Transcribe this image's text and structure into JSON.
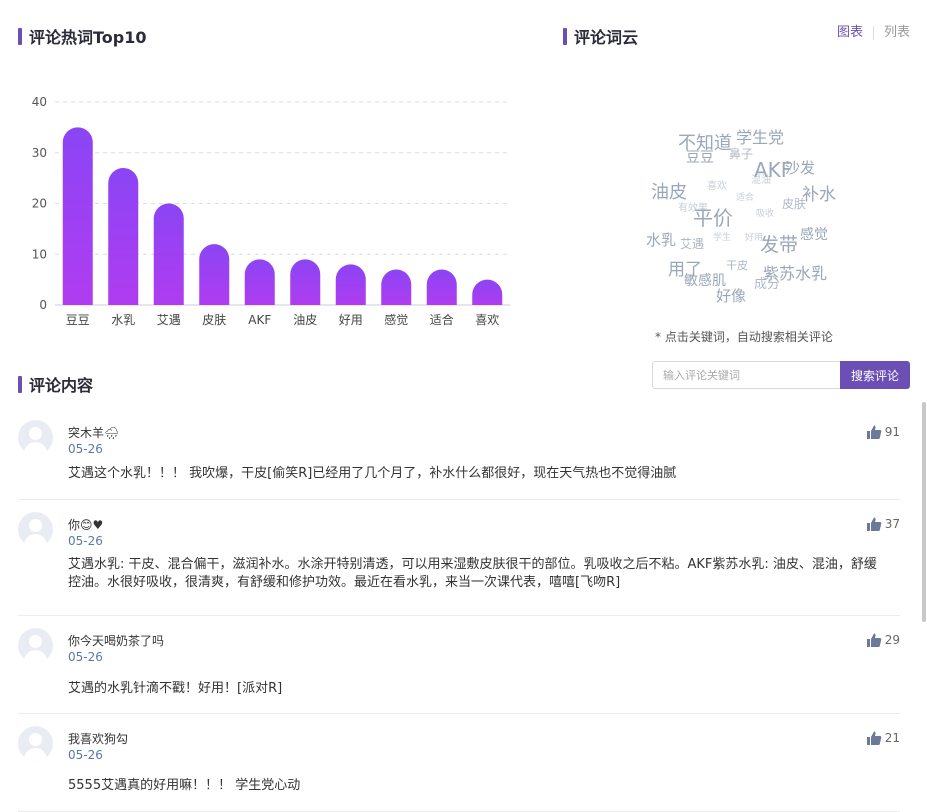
{
  "hot_words_section": {
    "title": "评论热词Top10"
  },
  "cloud_section": {
    "title": "评论词云",
    "tabs": [
      {
        "label": "图表",
        "active": true
      },
      {
        "label": "列表",
        "active": false
      }
    ],
    "hint": "* 点击关键词，自动搜索相关评论",
    "words": [
      {
        "text": "不知道",
        "size": 18
      },
      {
        "text": "学生党",
        "size": 16
      },
      {
        "text": "豆豆",
        "size": 14
      },
      {
        "text": "鼻子",
        "size": 12
      },
      {
        "text": "AKF",
        "size": 20
      },
      {
        "text": "沙发",
        "size": 15
      },
      {
        "text": "油皮",
        "size": 18
      },
      {
        "text": "喜欢",
        "size": 10
      },
      {
        "text": "混油",
        "size": 10
      },
      {
        "text": "补水",
        "size": 17
      },
      {
        "text": "有效果",
        "size": 10
      },
      {
        "text": "适合",
        "size": 9
      },
      {
        "text": "平价",
        "size": 20
      },
      {
        "text": "吸收",
        "size": 9
      },
      {
        "text": "皮肤",
        "size": 12
      },
      {
        "text": "水乳",
        "size": 15
      },
      {
        "text": "艾遇",
        "size": 12
      },
      {
        "text": "学生",
        "size": 9
      },
      {
        "text": "好用",
        "size": 9
      },
      {
        "text": "发带",
        "size": 19
      },
      {
        "text": "感觉",
        "size": 14
      },
      {
        "text": "用了",
        "size": 17
      },
      {
        "text": "干皮",
        "size": 11
      },
      {
        "text": "紫苏水乳",
        "size": 16
      },
      {
        "text": "敏感肌",
        "size": 14
      },
      {
        "text": "成分",
        "size": 13
      },
      {
        "text": "好像",
        "size": 15
      }
    ]
  },
  "search": {
    "placeholder": "输入评论关键词",
    "button_label": "搜索评论"
  },
  "comments_section": {
    "title": "评论内容",
    "items": [
      {
        "user": "突木羊🌧",
        "date": "05-26",
        "likes": "91",
        "text": "艾遇这个水乳！！！ 我吹爆，干皮[偷笑R]已经用了几个月了，补水什么都很好，现在天气热也不觉得油腻"
      },
      {
        "user": "你😊♥",
        "date": "05-26",
        "likes": "37",
        "text": "艾遇水乳: 干皮、混合偏干，滋润补水。水涂开特别清透，可以用来湿敷皮肤很干的部位。乳吸收之后不粘。AKF紫苏水乳: 油皮、混油，舒缓控油。水很好吸收，很清爽，有舒缓和修护功效。最近在看水乳，来当一次课代表，嘻嘻[飞吻R]"
      },
      {
        "user": "你今天喝奶茶了吗",
        "date": "05-26",
        "likes": "29",
        "text": "艾遇的水乳针滴不戳！好用！[派对R]"
      },
      {
        "user": "我喜欢狗勾",
        "date": "05-26",
        "likes": "21",
        "text": "5555艾遇真的好用嘛！！！ 学生党心动"
      }
    ]
  },
  "colors": {
    "accent": "#6c4fb4",
    "bar_top": "#8b45f5",
    "bar_bottom": "#b03cf0",
    "cloud_word": "#9aa7b8"
  },
  "chart_data": {
    "type": "bar",
    "categories": [
      "豆豆",
      "水乳",
      "艾遇",
      "皮肤",
      "AKF",
      "油皮",
      "好用",
      "感觉",
      "适合",
      "喜欢"
    ],
    "values": [
      35,
      27,
      20,
      12,
      9,
      9,
      8,
      7,
      7,
      5
    ],
    "ylim": [
      0,
      40
    ],
    "yticks": [
      0,
      10,
      20,
      30,
      40
    ],
    "grid": true,
    "title": "",
    "xlabel": "",
    "ylabel": ""
  }
}
